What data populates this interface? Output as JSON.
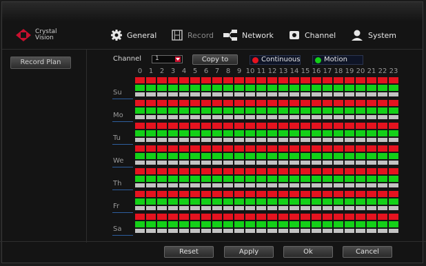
{
  "brand": {
    "line1": "Crystal",
    "line2": "Vision"
  },
  "nav": [
    {
      "label": "General",
      "icon": "gear-icon",
      "active": true
    },
    {
      "label": "Record",
      "icon": "film-icon",
      "active": false
    },
    {
      "label": "Network",
      "icon": "network-icon",
      "active": true
    },
    {
      "label": "Channel",
      "icon": "channel-icon",
      "active": true
    },
    {
      "label": "System",
      "icon": "user-icon",
      "active": true
    }
  ],
  "sidebar": {
    "record_plan": "Record Plan"
  },
  "toolbar": {
    "channel_label": "Channel",
    "channel_value": "1",
    "copy_to": "Copy to",
    "legend_continuous": "Continuous",
    "legend_motion": "Motion"
  },
  "colors": {
    "continuous": "#e5131f",
    "motion": "#14d018",
    "none": "#c3c3c3",
    "brand": "#c8102e"
  },
  "hours": [
    "0",
    "1",
    "2",
    "3",
    "4",
    "5",
    "6",
    "7",
    "8",
    "9",
    "10",
    "11",
    "12",
    "13",
    "14",
    "15",
    "16",
    "17",
    "18",
    "19",
    "20",
    "21",
    "22",
    "23"
  ],
  "days": [
    "Su",
    "Mo",
    "Tu",
    "We",
    "Th",
    "Fr",
    "Sa"
  ],
  "schedule_rows": [
    "Continuous",
    "Motion",
    "None"
  ],
  "footer": {
    "reset": "Reset",
    "apply": "Apply",
    "ok": "Ok",
    "cancel": "Cancel"
  }
}
